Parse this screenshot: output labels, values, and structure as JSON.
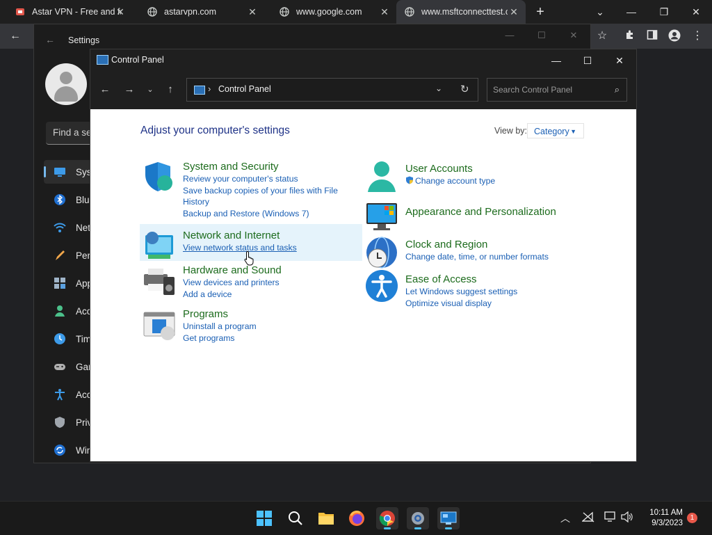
{
  "browser": {
    "tabs": [
      {
        "title": "Astar VPN - Free and fa",
        "icon": "astar-vpn-icon"
      },
      {
        "title": "astarvpn.com",
        "icon": "globe-icon"
      },
      {
        "title": "www.google.com",
        "icon": "globe-icon"
      },
      {
        "title": "www.msftconnecttest.c",
        "icon": "globe-icon",
        "active": true
      }
    ]
  },
  "settings": {
    "title": "Settings",
    "search_placeholder": "Find a se",
    "nav": [
      {
        "label": "Syst",
        "icon": "system-icon"
      },
      {
        "label": "Blue",
        "icon": "bluetooth-icon"
      },
      {
        "label": "Net",
        "icon": "network-icon"
      },
      {
        "label": "Pers",
        "icon": "personalization-icon"
      },
      {
        "label": "App",
        "icon": "apps-icon"
      },
      {
        "label": "Acc",
        "icon": "accounts-icon"
      },
      {
        "label": "Tim",
        "icon": "time-language-icon"
      },
      {
        "label": "Gar",
        "icon": "gaming-icon"
      },
      {
        "label": "Acc",
        "icon": "accessibility-icon"
      },
      {
        "label": "Priv",
        "icon": "privacy-icon"
      },
      {
        "label": "Win",
        "icon": "windows-update-icon"
      }
    ]
  },
  "control_panel": {
    "title": "Control Panel",
    "address": "Control Panel",
    "search_placeholder": "Search Control Panel",
    "heading": "Adjust your computer's settings",
    "view_by_label": "View by:",
    "view_by_value": "Category",
    "categories_left": [
      {
        "title": "System and Security",
        "links": [
          "Review your computer's status",
          "Save backup copies of your files with File",
          "History",
          "Backup and Restore (Windows 7)"
        ]
      },
      {
        "title": "Network and Internet",
        "links": [
          "View network status and tasks"
        ]
      },
      {
        "title": "Hardware and Sound",
        "links": [
          "View devices and printers",
          "Add a device"
        ]
      },
      {
        "title": "Programs",
        "links": [
          "Uninstall a program",
          "Get programs"
        ]
      }
    ],
    "categories_right": [
      {
        "title": "User Accounts",
        "links": [
          "Change account type"
        ]
      },
      {
        "title": "Appearance and Personalization",
        "links": []
      },
      {
        "title": "Clock and Region",
        "links": [
          "Change date, time, or number formats"
        ]
      },
      {
        "title": "Ease of Access",
        "links": [
          "Let Windows suggest settings",
          "Optimize visual display"
        ]
      }
    ]
  },
  "taskbar": {
    "time": "10:11 AM",
    "date": "9/3/2023",
    "notification_count": "1"
  },
  "colors": {
    "accent": "#4cc2ff",
    "category_title": "#1c6b1c",
    "link": "#1a5fb4",
    "heading": "#1e3287",
    "hover": "#e5f3fb"
  }
}
